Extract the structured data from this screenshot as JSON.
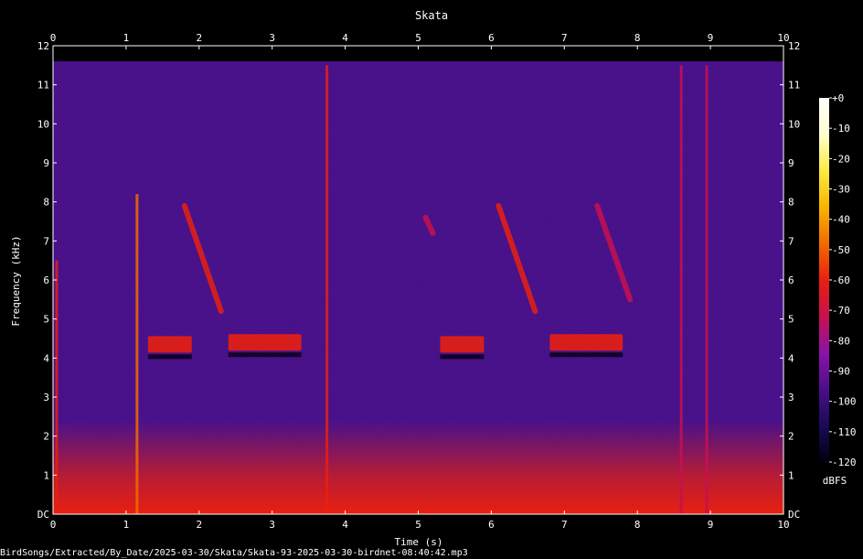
{
  "chart_data": {
    "type": "heatmap",
    "title": "Skata",
    "xlabel": "Time (s)",
    "ylabel": "Frequency (kHz)",
    "xlim": [
      0,
      10
    ],
    "ylim": [
      0,
      12
    ],
    "x_ticks": [
      0,
      1,
      2,
      3,
      4,
      5,
      6,
      7,
      8,
      9,
      10
    ],
    "y_ticks": [
      "DC",
      "1",
      "2",
      "3",
      "4",
      "5",
      "6",
      "7",
      "8",
      "9",
      "10",
      "11",
      "12"
    ],
    "colorbar": {
      "label": "dBFS",
      "ticks": [
        "+0",
        "-10",
        "-20",
        "-30",
        "-40",
        "-50",
        "-60",
        "-70",
        "-80",
        "-90",
        "-100",
        "-110",
        "-120"
      ],
      "range": [
        -120,
        0
      ],
      "colors": [
        "#000010",
        "#1a0a55",
        "#4a0f8a",
        "#8a12a8",
        "#c8104f",
        "#e82010",
        "#f26a00",
        "#f8b400",
        "#fbea40",
        "#ffffd0",
        "#ffffff"
      ]
    },
    "background_level_db": -95,
    "low_frequency_floor": {
      "freq_khz_max": 1.5,
      "level_db": -55
    },
    "vertical_transients": [
      {
        "t": 0.05,
        "f_lo": 0.0,
        "f_hi": 6.5,
        "level_db": -55
      },
      {
        "t": 1.15,
        "f_lo": 0.0,
        "f_hi": 8.2,
        "level_db": -45
      },
      {
        "t": 3.75,
        "f_lo": 0.0,
        "f_hi": 11.5,
        "level_db": -55
      },
      {
        "t": 8.6,
        "f_lo": 0.0,
        "f_hi": 11.5,
        "level_db": -70
      },
      {
        "t": 8.95,
        "f_lo": 0.0,
        "f_hi": 11.5,
        "level_db": -70
      }
    ],
    "harmonic_bands": [
      {
        "t_start": 2.4,
        "t_end": 3.4,
        "f_khz": 4.4,
        "level_db": -55
      },
      {
        "t_start": 6.8,
        "t_end": 7.8,
        "f_khz": 4.4,
        "level_db": -55
      },
      {
        "t_start": 1.3,
        "t_end": 1.9,
        "f_khz": 4.35,
        "level_db": -60
      },
      {
        "t_start": 5.3,
        "t_end": 5.9,
        "f_khz": 4.35,
        "level_db": -60
      }
    ],
    "descending_sweeps": [
      {
        "t_start": 1.8,
        "t_end": 2.3,
        "f_start": 7.9,
        "f_end": 5.2,
        "level_db": -65
      },
      {
        "t_start": 6.1,
        "t_end": 6.6,
        "f_start": 7.9,
        "f_end": 5.2,
        "level_db": -65
      },
      {
        "t_start": 7.45,
        "t_end": 7.9,
        "f_start": 7.9,
        "f_end": 5.5,
        "level_db": -68
      },
      {
        "t_start": 5.1,
        "t_end": 5.2,
        "f_start": 7.6,
        "f_end": 7.2,
        "level_db": -70
      }
    ]
  },
  "caption": "BirdSongs/Extracted/By_Date/2025-03-30/Skata/Skata-93-2025-03-30-birdnet-08:40:42.mp3"
}
